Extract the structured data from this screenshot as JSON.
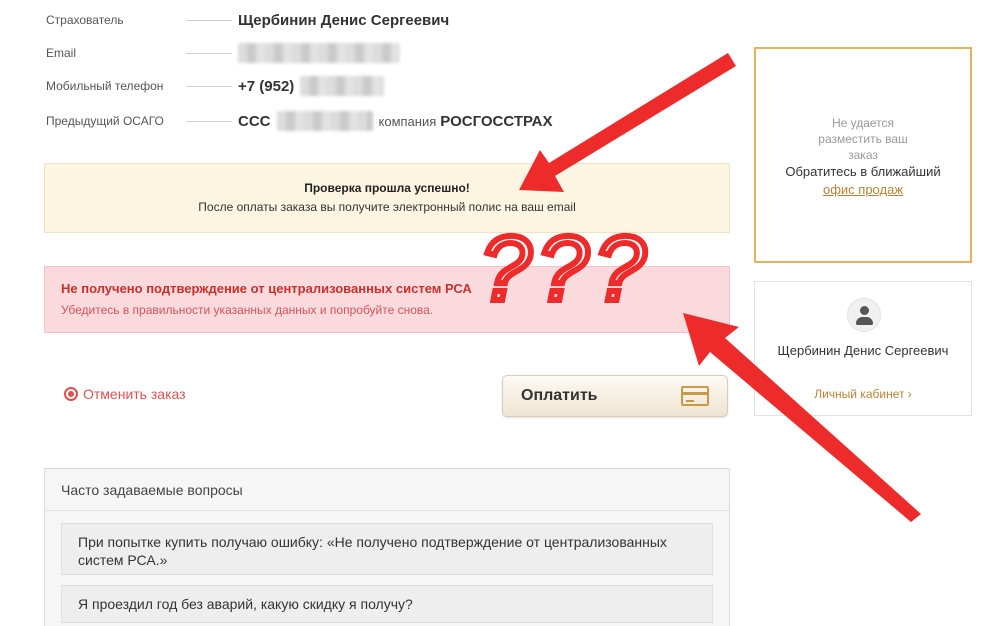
{
  "info": {
    "insured_label": "Страхователь",
    "insured_value": "Щербинин Денис Сергеевич",
    "email_label": "Email",
    "phone_label": "Мобильный телефон",
    "phone_prefix": "+7 (952)",
    "prev_label": "Предыдущий ОСАГО",
    "prev_prefix": "ССС",
    "prev_company_word": "компания",
    "prev_company": "РОСГОССТРАХ"
  },
  "success": {
    "title": "Проверка прошла успешно!",
    "subtitle": "После оплаты заказа вы получите электронный полис на ваш email"
  },
  "error": {
    "title": "Не получено подтверждение от централизованных систем РСА",
    "subtitle": "Убедитесь в правильности указанных данных и попробуйте снова."
  },
  "actions": {
    "cancel_label": "Отменить заказ",
    "pay_label": "Оплатить"
  },
  "faq": {
    "header": "Часто задаваемые вопросы",
    "items": [
      "При попытке купить получаю ошибку: «Не получено подтверждение от централизованных систем РСА.»",
      "Я проездил год без аварий, какую скидку я получу?"
    ]
  },
  "side_order": {
    "muted": "Не удается разместить ваш заказ",
    "contact": "Обратитесь в ближайший",
    "link": "офис продаж"
  },
  "side_user": {
    "name": "Щербинин Денис Сергеевич",
    "cabinet": "Личный кабинет ›"
  },
  "annotation": {
    "question_marks": "???",
    "color": "#ee2b2b"
  }
}
